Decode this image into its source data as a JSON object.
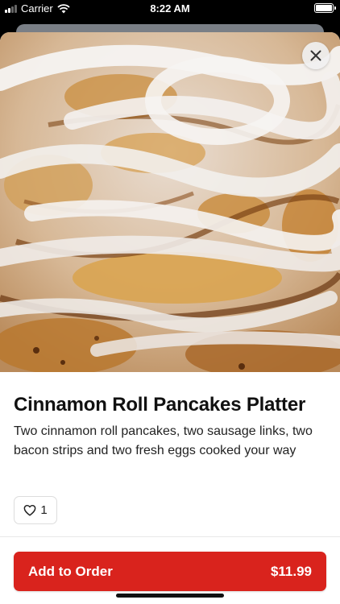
{
  "status_bar": {
    "carrier": "Carrier",
    "time": "8:22 AM"
  },
  "item": {
    "image_description": "Cinnamon roll pancakes with white icing",
    "title": "Cinnamon Roll Pancakes Platter",
    "description": "Two cinnamon roll pancakes, two sausage links, two bacon strips and two fresh eggs cooked your way",
    "like_count": "1"
  },
  "footer": {
    "add_button_label": "Add to Order",
    "price": "$11.99"
  },
  "colors": {
    "accent": "#d9231d",
    "text": "#111111"
  },
  "icons": {
    "close": "close-icon",
    "like": "heart-icon",
    "wifi": "wifi-icon",
    "battery": "battery-icon"
  }
}
